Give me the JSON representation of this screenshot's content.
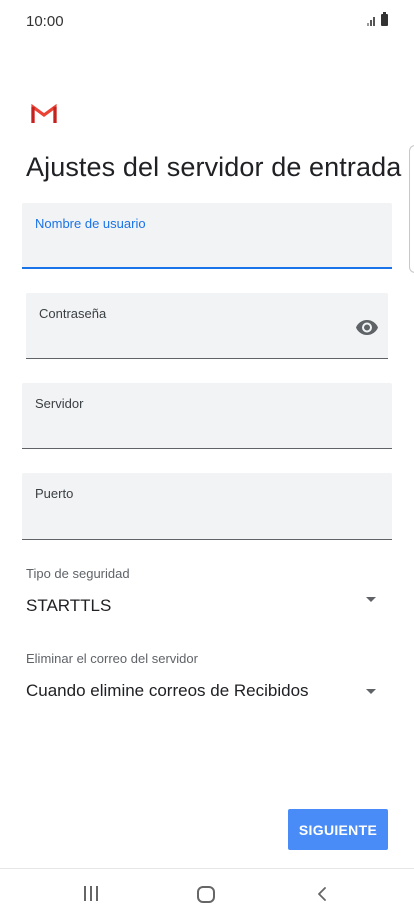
{
  "status_bar": {
    "time": "10:00",
    "signal_icon": "signal-icon",
    "battery_icon": "battery-icon"
  },
  "header": {
    "logo_icon": "gmail-icon",
    "title": "Ajustes del servidor de entrada"
  },
  "form": {
    "username": {
      "label": "Nombre de usuario",
      "value": ""
    },
    "password": {
      "label": "Contraseña",
      "value": "",
      "toggle_icon": "eye-icon"
    },
    "server": {
      "label": "Servidor",
      "value": ""
    },
    "port": {
      "label": "Puerto",
      "value": ""
    },
    "security_type": {
      "label": "Tipo de seguridad",
      "value": "STARTTLS"
    },
    "delete_mail": {
      "label": "Eliminar el correo del servidor",
      "value": "Cuando elimine correos de Recibidos"
    }
  },
  "actions": {
    "next_label": "SIGUIENTE"
  },
  "colors": {
    "accent": "#1a73e8",
    "button": "#4a8cf7",
    "field_bg": "#f1f3f4",
    "gmail_red": "#ea4335"
  },
  "nav": {
    "recent_icon": "recent-apps-icon",
    "home_icon": "home-icon",
    "back_icon": "back-icon"
  }
}
